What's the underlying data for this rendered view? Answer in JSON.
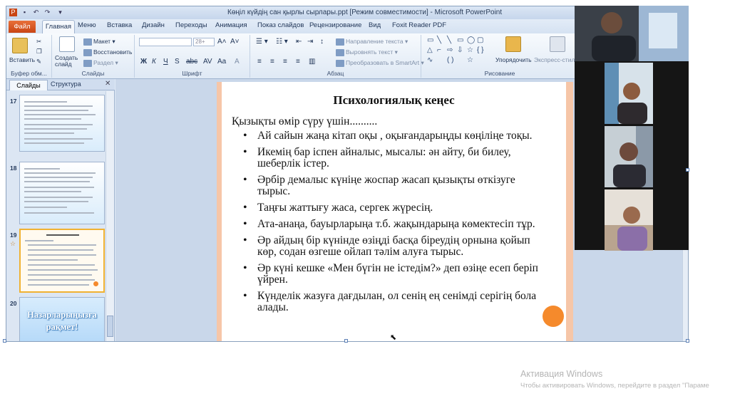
{
  "window": {
    "title": "Көңіл күйдің сан қырлы сырлары.ppt [Режим совместимости] - Microsoft PowerPoint"
  },
  "tabs": {
    "file": "Файл",
    "home": "Главная",
    "items": [
      "Меню",
      "Вставка",
      "Дизайн",
      "Переходы",
      "Анимация",
      "Показ слайдов",
      "Рецензирование",
      "Вид",
      "Foxit Reader PDF"
    ]
  },
  "ribbon": {
    "paste": "Вставить",
    "clipboard_group": "Буфер обм...",
    "create_slide": "Создать слайд",
    "layout": "Макет",
    "reset": "Восстановить",
    "section": "Раздел",
    "slides_group": "Слайды",
    "font_size": "28+",
    "font_group": "Шрифт",
    "text_direction": "Направление текста",
    "align_text": "Выровнять текст",
    "smartart": "Преобразовать в SmartArt",
    "paragraph_group": "Абзац",
    "arrange": "Упорядочить",
    "quick_styles": "Экспресс-стили",
    "drawing_group": "Рисование"
  },
  "pane": {
    "tab_slides": "Слайды",
    "tab_outline": "Структура",
    "slide_numbers": [
      "17",
      "18",
      "19",
      "20"
    ],
    "slide20_text": "Назарларыңызға рақмет!"
  },
  "slide": {
    "title": "Психологиялық кеңес",
    "intro": "Қызықты өмір сүру үшін..........",
    "bullets": [
      "Ай сайын жаңа кітап оқы , оқығандарыңды көңіліңе тоқы.",
      "Икемің бар іспен айналыс, мысалы: ән айту, би билеу, шеберлік істер.",
      "Әрбір демалыс күніңе жоспар жасап қызықты өткізуге тырыс.",
      "Таңғы жаттығу жаса, сергек жүресің.",
      "Ата-анаңа, бауырларыңа т.б. жақындарыңа көмектесіп тұр.",
      "Әр айдың бір күнінде өзіңді басқа біреудің орнына қойып көр, содан өзгеше ойлап тәлім алуға тырыс.",
      "Әр күні кешке «Мен бүгін не істедім?» деп өзіңе есеп беріп үйрен.",
      "Күнделік жазуға дағдылан, ол сенің ең сенімді серігің бола алады."
    ]
  },
  "watermark": {
    "title": "Активация Windows",
    "subtitle": "Чтобы активировать Windows, перейдите в раздел \"Параме"
  },
  "colors": {
    "accent_orange": "#f58a2c",
    "file_tab": "#d9541f",
    "slide_border": "#f6c6a8"
  }
}
